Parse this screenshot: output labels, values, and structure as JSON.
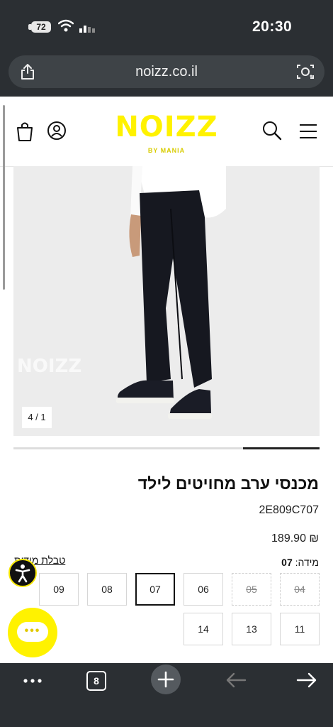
{
  "status_bar": {
    "battery": "72",
    "time": "20:30"
  },
  "browser": {
    "url": "noizz.co.il",
    "tab_count": "8"
  },
  "header": {
    "brand": "NOIZZ",
    "brand_sub": "BY MANIA"
  },
  "gallery": {
    "counter": "4 / 1",
    "watermark": "NOIZZ",
    "progress_fraction": 0.25
  },
  "product": {
    "title": "מכנסי ערב מחויטים לילד",
    "sku": "2E809C707",
    "price": "₪ 189.90",
    "size_label": "מידה:",
    "selected_size": "07",
    "size_table_link": "טבלת מידות",
    "sizes_row1": [
      {
        "label": "04",
        "state": "disabled"
      },
      {
        "label": "05",
        "state": "disabled"
      },
      {
        "label": "06",
        "state": "available"
      },
      {
        "label": "07",
        "state": "selected"
      },
      {
        "label": "08",
        "state": "available"
      },
      {
        "label": "09",
        "state": "available"
      }
    ],
    "sizes_row2": [
      {
        "label": "11",
        "state": "available"
      },
      {
        "label": "13",
        "state": "available"
      },
      {
        "label": "14",
        "state": "available"
      }
    ]
  },
  "colors": {
    "brand_yellow": "#FFF200",
    "browser_chrome": "#2B2F33"
  }
}
